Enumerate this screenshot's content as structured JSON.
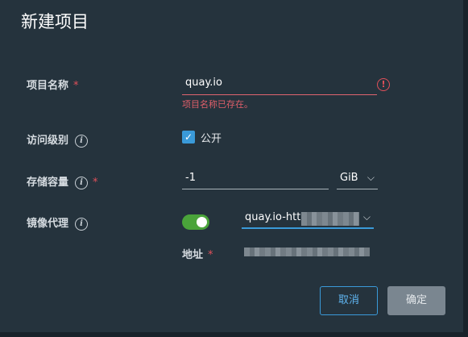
{
  "dialog": {
    "title": "新建项目"
  },
  "form": {
    "project_name": {
      "label": "项目名称",
      "required_mark": "*",
      "value": "quay.io",
      "error_icon": "exclamation-circle-icon",
      "error_text": "项目名称已存在。"
    },
    "access_level": {
      "label": "访问级别",
      "info_icon": "info-icon",
      "checkbox_checked": true,
      "checkbox_label": "公开"
    },
    "storage_quota": {
      "label": "存储容量",
      "info_icon": "info-icon",
      "required_mark": "*",
      "value": "-1",
      "unit": "GiB"
    },
    "proxy_cache": {
      "label": "镜像代理",
      "info_icon": "info-icon",
      "enabled": true,
      "registry_value": "quay.io-htt",
      "address_label": "地址",
      "address_required_mark": "*"
    }
  },
  "buttons": {
    "cancel": "取消",
    "confirm": "确定"
  },
  "colors": {
    "accent": "#3a9ad9",
    "error": "#e0505a",
    "toggle_on": "#4aa43a",
    "modal_bg": "#25333d"
  }
}
